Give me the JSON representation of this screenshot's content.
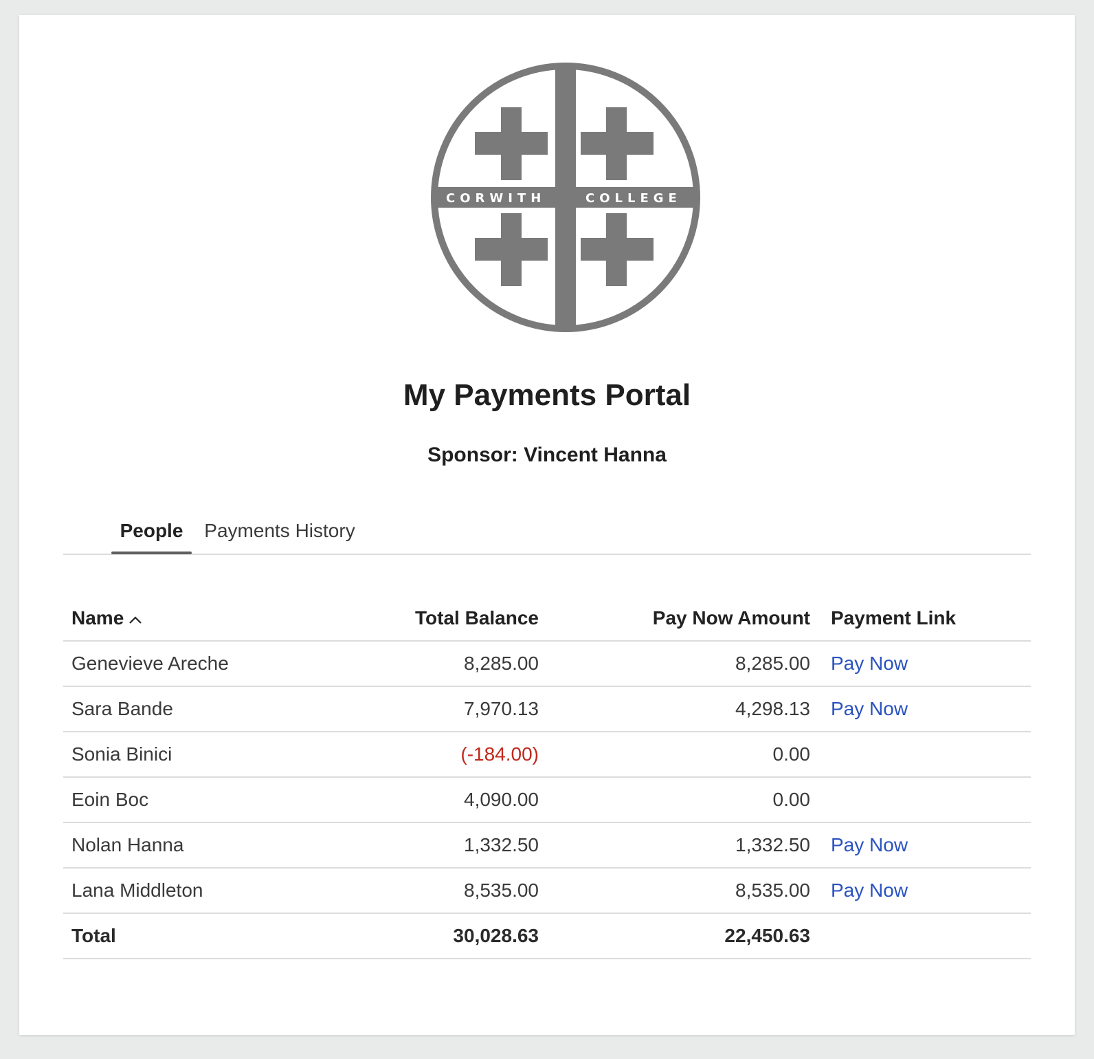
{
  "logo": {
    "text_left": "CORWITH",
    "text_right": "COLLEGE",
    "color": "#7a7a7a"
  },
  "title": "My Payments Portal",
  "sponsor": "Sponsor: Vincent Hanna",
  "tabs": [
    {
      "label": "People",
      "active": true
    },
    {
      "label": "Payments History",
      "active": false
    }
  ],
  "table": {
    "headers": {
      "name": "Name",
      "total_balance": "Total Balance",
      "pay_now_amount": "Pay Now Amount",
      "payment_link": "Payment Link"
    },
    "sort": {
      "column": "name",
      "direction": "ascending"
    },
    "rows": [
      {
        "name": "Genevieve Areche",
        "total_balance": "8,285.00",
        "pay_now_amount": "8,285.00",
        "payment_link": "Pay Now"
      },
      {
        "name": "Sara Bande",
        "total_balance": "7,970.13",
        "pay_now_amount": "4,298.13",
        "payment_link": "Pay Now"
      },
      {
        "name": "Sonia Binici",
        "total_balance": "(-184.00)",
        "pay_now_amount": "0.00",
        "payment_link": ""
      },
      {
        "name": "Eoin Boc",
        "total_balance": "4,090.00",
        "pay_now_amount": "0.00",
        "payment_link": ""
      },
      {
        "name": "Nolan Hanna",
        "total_balance": "1,332.50",
        "pay_now_amount": "1,332.50",
        "payment_link": "Pay Now"
      },
      {
        "name": "Lana Middleton",
        "total_balance": "8,535.00",
        "pay_now_amount": "8,535.00",
        "payment_link": "Pay Now"
      }
    ],
    "total": {
      "label": "Total",
      "total_balance": "30,028.63",
      "pay_now_amount": "22,450.63"
    }
  },
  "colors": {
    "link": "#2a53c0",
    "negative": "#c0281c",
    "background": "#e9eaea"
  }
}
